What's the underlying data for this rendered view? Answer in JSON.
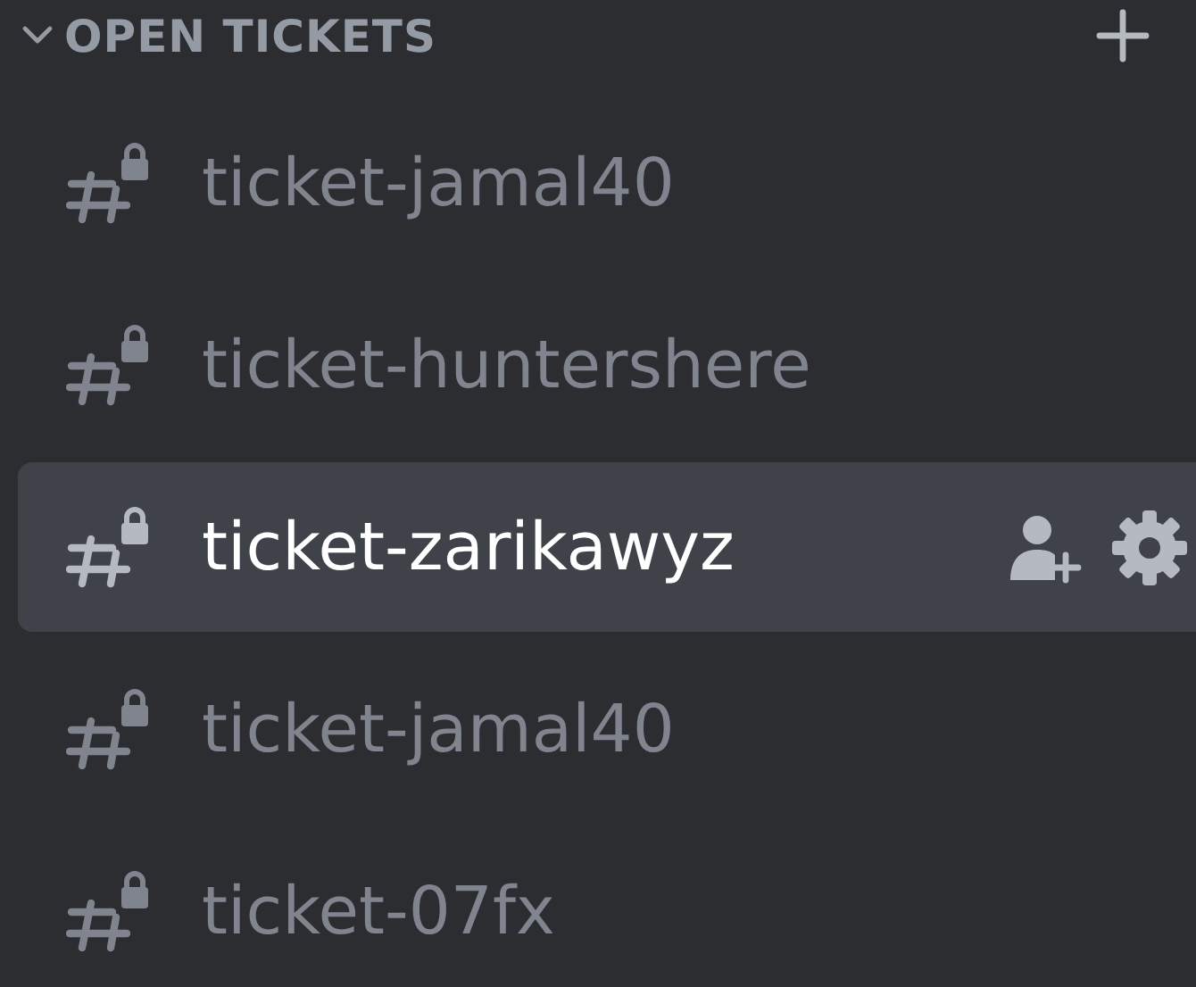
{
  "category": {
    "title": "OPEN TICKETS",
    "expanded": true
  },
  "channels": [
    {
      "name": "ticket-jamal40",
      "selected": false
    },
    {
      "name": "ticket-huntershere",
      "selected": false
    },
    {
      "name": "ticket-zarikawyz",
      "selected": true
    },
    {
      "name": "ticket-jamal40",
      "selected": false
    },
    {
      "name": "ticket-07fx",
      "selected": false
    }
  ]
}
